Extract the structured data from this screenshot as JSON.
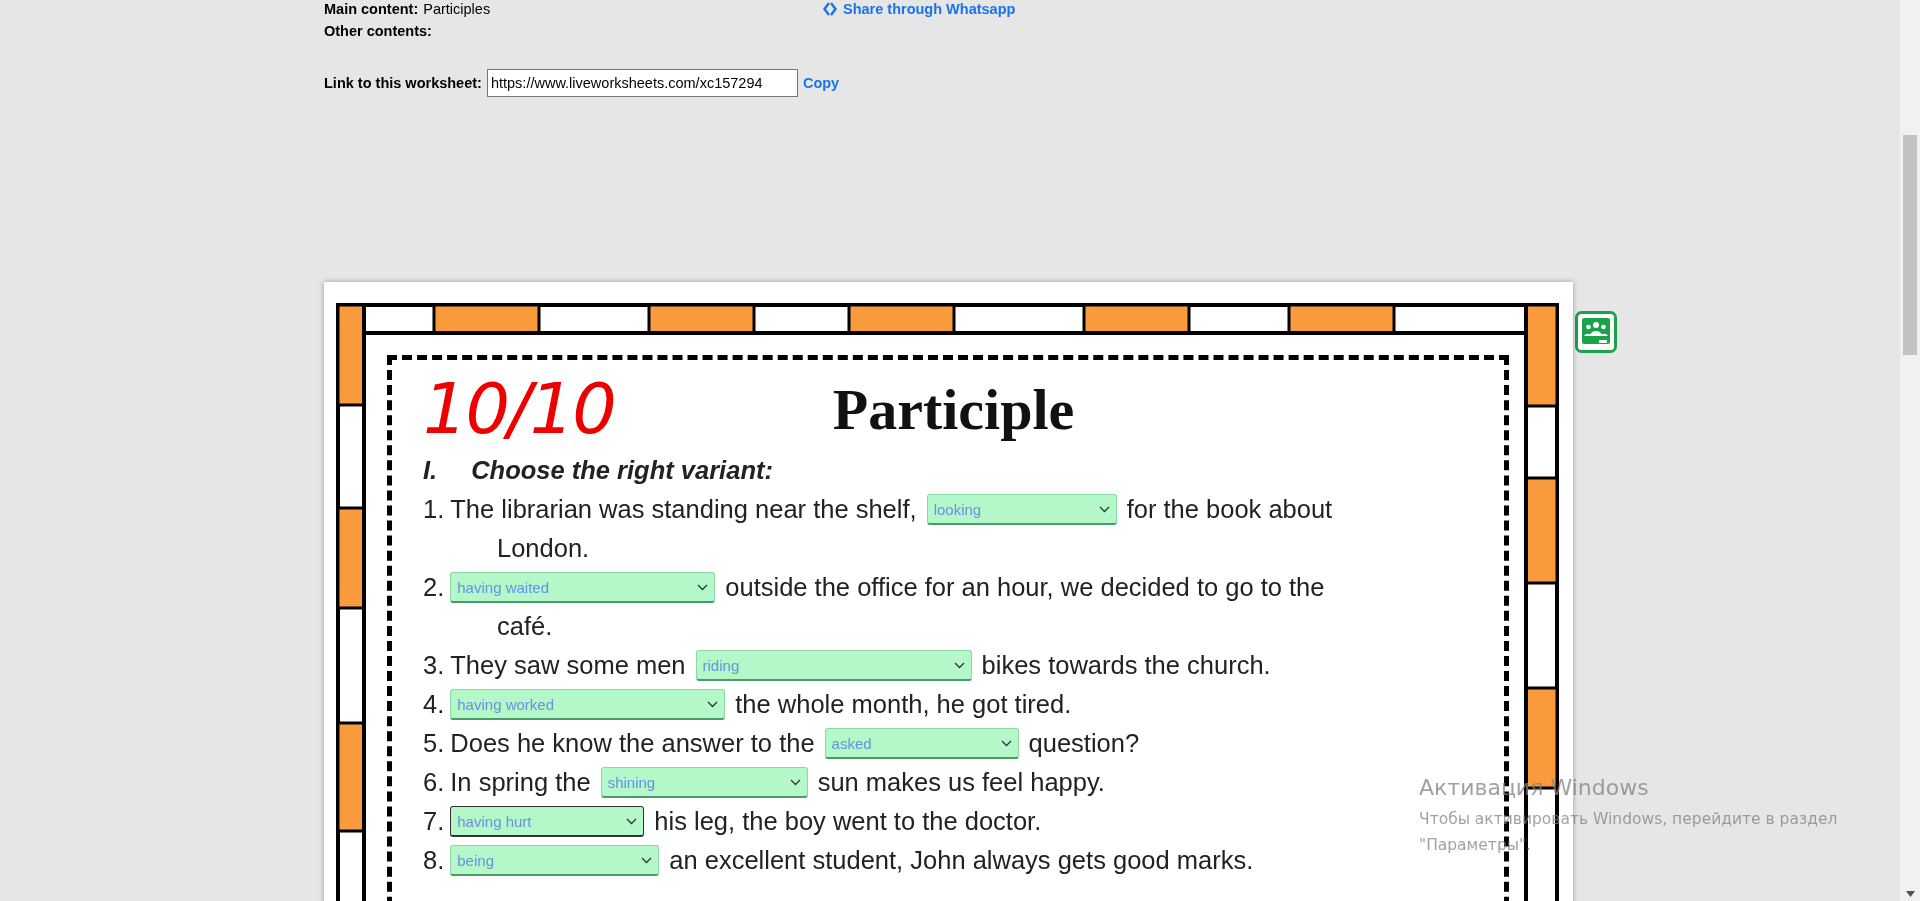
{
  "info": {
    "main_content_label": "Main content:",
    "main_content_value": "Participles",
    "other_contents_label": "Other contents:",
    "share_link": "Share through Whatsapp",
    "link_label": "Link to this worksheet:",
    "link_value": "https://www.liveworksheets.com/xc157294",
    "copy": "Copy"
  },
  "worksheet": {
    "title": "Participle",
    "score": "10/10",
    "section_number": "I.",
    "section_title": "Choose the right variant:",
    "items": [
      {
        "number": "1.",
        "lines": [
          [
            {
              "kind": "text",
              "text": "The librarian was standing near the shelf,"
            },
            {
              "kind": "select",
              "value": "looking",
              "focused": false
            },
            {
              "kind": "text",
              "text": "for the book about"
            }
          ],
          [
            {
              "kind": "text",
              "text": "London."
            }
          ]
        ]
      },
      {
        "number": "2.",
        "lines": [
          [
            {
              "kind": "select",
              "value": "having waited",
              "focused": false
            },
            {
              "kind": "text",
              "text": "outside the office for an hour, we decided to go to the"
            }
          ],
          [
            {
              "kind": "text",
              "text": "café."
            }
          ]
        ]
      },
      {
        "number": "3.",
        "lines": [
          [
            {
              "kind": "text",
              "text": "They saw some men"
            },
            {
              "kind": "select",
              "value": "riding",
              "focused": false
            },
            {
              "kind": "text",
              "text": "bikes towards the church."
            }
          ]
        ]
      },
      {
        "number": "4.",
        "lines": [
          [
            {
              "kind": "select",
              "value": "having worked",
              "focused": false
            },
            {
              "kind": "text",
              "text": "the whole month, he got tired."
            }
          ]
        ]
      },
      {
        "number": "5.",
        "lines": [
          [
            {
              "kind": "text",
              "text": "Does he know the answer to the"
            },
            {
              "kind": "select",
              "value": "asked",
              "focused": false
            },
            {
              "kind": "text",
              "text": "question?"
            }
          ]
        ]
      },
      {
        "number": "6.",
        "lines": [
          [
            {
              "kind": "text",
              "text": "In spring the"
            },
            {
              "kind": "select",
              "value": "shining",
              "focused": false
            },
            {
              "kind": "text",
              "text": "sun makes us feel happy."
            }
          ]
        ]
      },
      {
        "number": "7.",
        "lines": [
          [
            {
              "kind": "select",
              "value": "having hurt",
              "focused": true
            },
            {
              "kind": "text",
              "text": "his leg, the boy went to the doctor."
            }
          ]
        ]
      },
      {
        "number": "8.",
        "lines": [
          [
            {
              "kind": "select",
              "value": "being",
              "focused": false
            },
            {
              "kind": "text",
              "text": "an excellent student, John always gets good marks."
            }
          ]
        ]
      }
    ]
  },
  "os_notice": {
    "title": "Активация Windows",
    "text": "Чтобы активировать Windows, перейдите в раздел",
    "text_2": "\"Параметры\"."
  }
}
